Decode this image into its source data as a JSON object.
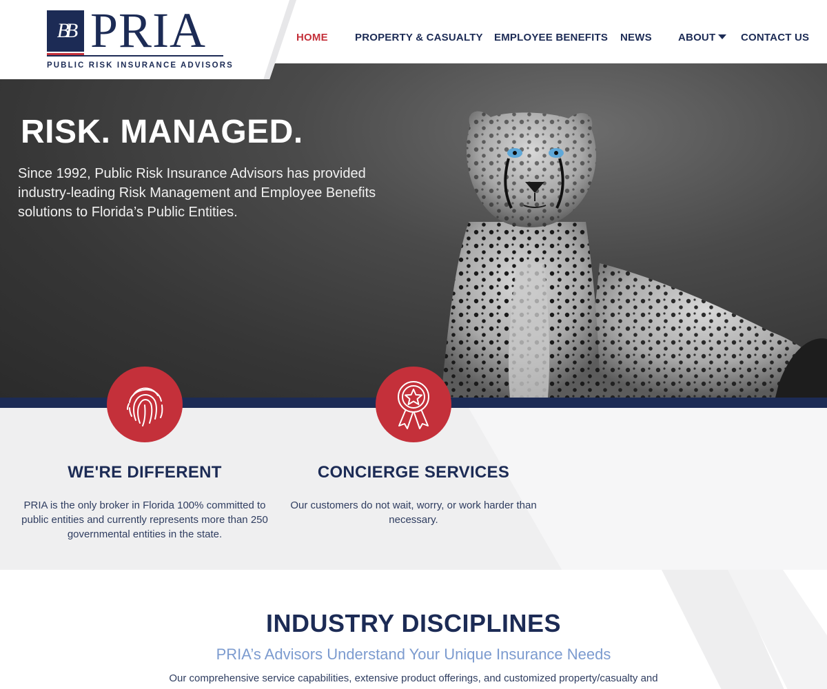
{
  "brand": {
    "logo_mark": "BB",
    "logo_word": "PRIA",
    "logo_sub": "PUBLIC RISK INSURANCE ADVISORS",
    "colors": {
      "navy": "#1c2b55",
      "red": "#c4303a",
      "light_blue": "#7c9bcf"
    }
  },
  "nav": {
    "items": [
      {
        "label": "HOME",
        "active": true
      },
      {
        "label": "PROPERTY & CASUALTY",
        "active": false
      },
      {
        "label": "EMPLOYEE BENEFITS",
        "active": false
      },
      {
        "label": "NEWS",
        "active": false
      },
      {
        "label": "ABOUT",
        "active": false,
        "has_dropdown": true
      },
      {
        "label": "CONTACT US",
        "active": false
      }
    ]
  },
  "hero": {
    "headline": "RISK. MANAGED.",
    "body": "Since 1992, Public Risk Insurance Advisors has provided industry-leading Risk Management and Employee Benefits solutions to Florida’s Public Entities."
  },
  "features": [
    {
      "icon": "fingerprint-icon",
      "title": "WE'RE DIFFERENT",
      "text": "PRIA is the only broker in Florida 100% committed to public entities and currently represents more than 250 governmental entities in the state."
    },
    {
      "icon": "award-ribbon-icon",
      "title": "CONCIERGE SERVICES",
      "text": "Our customers do not wait, worry, or work harder than necessary."
    }
  ],
  "disciplines": {
    "title": "INDUSTRY DISCIPLINES",
    "subtitle": "PRIA’s Advisors Understand Your Unique Insurance Needs",
    "body": "Our comprehensive service capabilities, extensive product offerings, and customized property/casualty and"
  }
}
